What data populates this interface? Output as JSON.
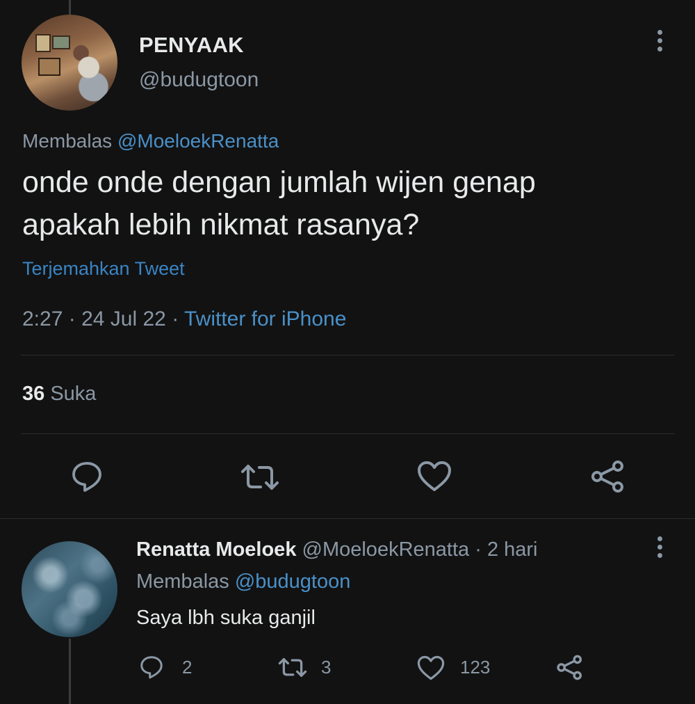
{
  "tweet": {
    "author_name": "PENYAAK",
    "author_handle": "@budugtoon",
    "replying_prefix": "Membalas",
    "replying_to": "@MoeloekRenatta",
    "text_line1": "onde onde dengan jumlah wijen genap",
    "text_line2": "apakah lebih nikmat rasanya?",
    "translate_label": "Terjemahkan Tweet",
    "time": "2:27",
    "date": "24 Jul 22",
    "separator": "·",
    "source": "Twitter for iPhone",
    "likes_count": "36",
    "likes_label": "Suka"
  },
  "reply": {
    "author_name": "Renatta Moeloek",
    "author_handle": "@MoeloekRenatta",
    "separator": "·",
    "age": "2 hari",
    "replying_prefix": "Membalas",
    "replying_to": "@budugtoon",
    "text": "Saya lbh suka ganjil",
    "reply_count": "2",
    "retweet_count": "3",
    "like_count": "123"
  },
  "icons": {
    "reply": "reply-icon",
    "retweet": "retweet-icon",
    "like": "heart-icon",
    "share": "share-icon",
    "more": "more-icon"
  },
  "colors": {
    "background": "#121212",
    "text": "#e7e9ea",
    "muted": "#8b98a5",
    "link": "#4a90c8"
  }
}
